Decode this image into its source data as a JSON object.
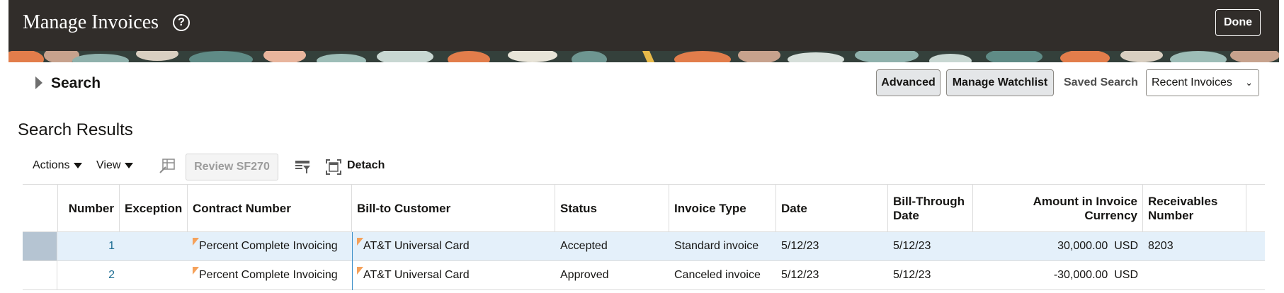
{
  "header": {
    "title": "Manage Invoices",
    "help_icon": "?",
    "done_label": "Done"
  },
  "search": {
    "label": "Search",
    "advanced_label": "Advanced",
    "manage_watchlist_label": "Manage Watchlist",
    "saved_search_label": "Saved Search",
    "saved_search_value": "Recent Invoices"
  },
  "results": {
    "title": "Search Results",
    "toolbar": {
      "actions_label": "Actions",
      "view_label": "View",
      "review_label": "Review SF270",
      "detach_label": "Detach"
    },
    "columns": [
      "Number",
      "Exception",
      "Contract Number",
      "Bill-to Customer",
      "Status",
      "Invoice Type",
      "Date",
      "Bill-Through Date",
      "Amount in Invoice Currency",
      "Receivables Number"
    ],
    "rows": [
      {
        "number": "1",
        "exception": "",
        "contract": "Percent Complete Invoicing",
        "customer": "AT&T Universal Card",
        "status": "Accepted",
        "type": "Standard invoice",
        "date": "5/12/23",
        "through": "5/12/23",
        "amount": "30,000.00",
        "currency": "USD",
        "receivables": "8203"
      },
      {
        "number": "2",
        "exception": "",
        "contract": "Percent Complete Invoicing",
        "customer": "AT&T Universal Card",
        "status": "Approved",
        "type": "Canceled invoice",
        "date": "5/12/23",
        "through": "5/12/23",
        "amount": "-30,000.00",
        "currency": "USD",
        "receivables": ""
      }
    ]
  },
  "colors": {
    "header_bg": "#312d2a",
    "selected_row": "#e4f0fa",
    "link": "#1a6b91",
    "flag": "#f5a15a"
  },
  "icons": [
    "help-icon",
    "search-toggle-icon",
    "chevron-down-icon",
    "freeze-icon",
    "query-by-example-icon",
    "detach-icon",
    "flag-icon"
  ]
}
